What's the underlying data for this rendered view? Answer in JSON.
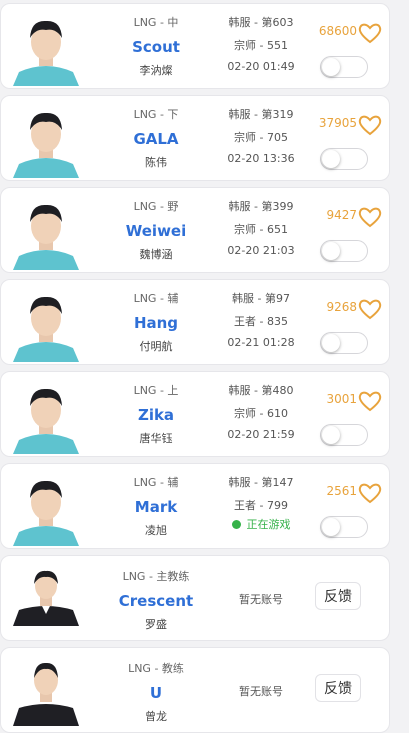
{
  "colors": {
    "accent_blue": "#2f6fd6",
    "likes_orange": "#e8a33c",
    "jersey_teal": "#5ec3cf",
    "online_green": "#36b24a"
  },
  "players": [
    {
      "team_role": "LNG - 中",
      "name": "Scout",
      "real_name": "李汭燦",
      "rank": "韩服 - 第603",
      "tier": "宗师 - 551",
      "status": "02-20 01:49",
      "likes": "68600"
    },
    {
      "team_role": "LNG - 下",
      "name": "GALA",
      "real_name": "陈伟",
      "rank": "韩服 - 第319",
      "tier": "宗师 - 705",
      "status": "02-20 13:36",
      "likes": "37905"
    },
    {
      "team_role": "LNG - 野",
      "name": "Weiwei",
      "real_name": "魏博涵",
      "rank": "韩服 - 第399",
      "tier": "宗师 - 651",
      "status": "02-20 21:03",
      "likes": "9427"
    },
    {
      "team_role": "LNG - 辅",
      "name": "Hang",
      "real_name": "付明航",
      "rank": "韩服 - 第97",
      "tier": "王者 - 835",
      "status": "02-21 01:28",
      "likes": "9268"
    },
    {
      "team_role": "LNG - 上",
      "name": "Zika",
      "real_name": "唐华钰",
      "rank": "韩服 - 第480",
      "tier": "宗师 - 610",
      "status": "02-20 21:59",
      "likes": "3001"
    },
    {
      "team_role": "LNG - 辅",
      "name": "Mark",
      "real_name": "凌旭",
      "rank": "韩服 - 第147",
      "tier": "王者 - 799",
      "status": "正在游戏",
      "likes": "2561"
    }
  ],
  "coaches": [
    {
      "team_role": "LNG - 主教练",
      "name": "Crescent",
      "real_name": "罗盛",
      "account": "暂无账号",
      "feedback_label": "反馈"
    },
    {
      "team_role": "LNG - 教练",
      "name": "U",
      "real_name": "曾龙",
      "account": "暂无账号",
      "feedback_label": "反馈"
    }
  ]
}
